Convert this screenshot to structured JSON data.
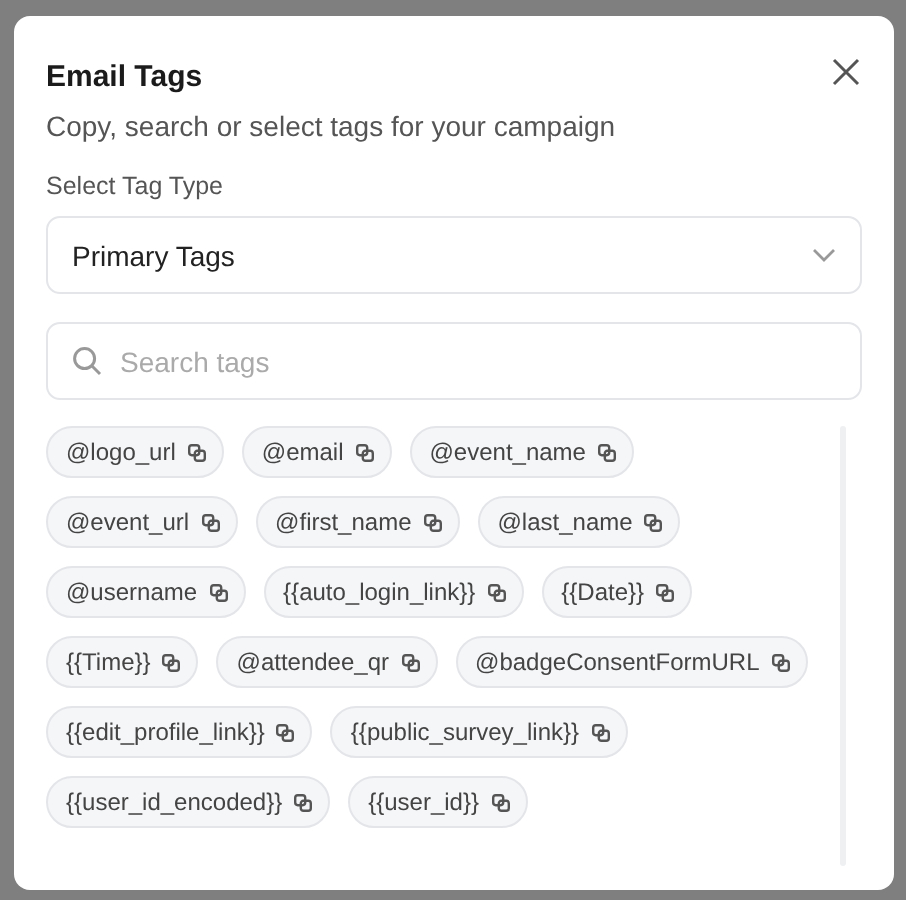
{
  "dialog": {
    "title": "Email Tags",
    "subtitle": "Copy, search or select tags for your campaign"
  },
  "tag_type": {
    "label": "Select Tag Type",
    "value": "Primary Tags"
  },
  "search": {
    "placeholder": "Search tags"
  },
  "tags": [
    {
      "label": "@logo_url"
    },
    {
      "label": "@email"
    },
    {
      "label": "@event_name"
    },
    {
      "label": "@event_url"
    },
    {
      "label": "@first_name"
    },
    {
      "label": "@last_name"
    },
    {
      "label": "@username"
    },
    {
      "label": "{{auto_login_link}}"
    },
    {
      "label": "{{Date}}"
    },
    {
      "label": "{{Time}}"
    },
    {
      "label": "@attendee_qr"
    },
    {
      "label": "@badgeConsentFormURL"
    },
    {
      "label": "{{edit_profile_link}}"
    },
    {
      "label": "{{public_survey_link}}"
    },
    {
      "label": "{{user_id_encoded}}"
    },
    {
      "label": "{{user_id}}"
    }
  ]
}
